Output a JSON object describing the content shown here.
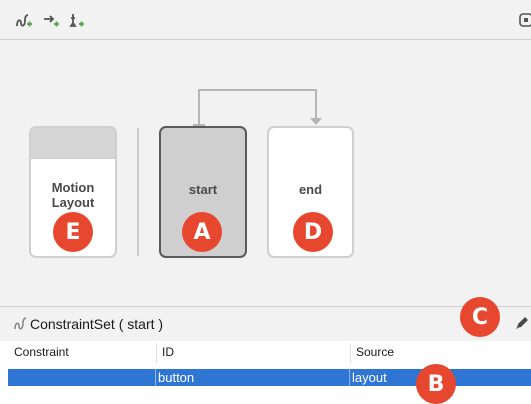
{
  "toolbar": {
    "icons": [
      "create-constraint-set-icon",
      "create-transition-icon",
      "create-click-handler-icon",
      "toggle-panel-icon"
    ]
  },
  "canvas": {
    "cards": {
      "motion_layout": {
        "label_line1": "Motion",
        "label_line2": "Layout",
        "badge": "E"
      },
      "start": {
        "label": "start",
        "badge": "A"
      },
      "end": {
        "label": "end",
        "badge": "D"
      }
    },
    "colors": {
      "badge": "#e8472f",
      "selected_card": "#cfcfcf",
      "transition_arrow": "#b5b5b5"
    }
  },
  "panel": {
    "title": "ConstraintSet ( start )",
    "badge_c": "C",
    "edit_icon": "pencil-icon"
  },
  "table": {
    "columns": [
      "Constraint",
      "ID",
      "Source"
    ],
    "rows": [
      {
        "constraint": "",
        "id": "button",
        "source": "layout",
        "selected": true
      }
    ],
    "badge_b": "B",
    "colors": {
      "selection": "#2f76d4"
    }
  }
}
